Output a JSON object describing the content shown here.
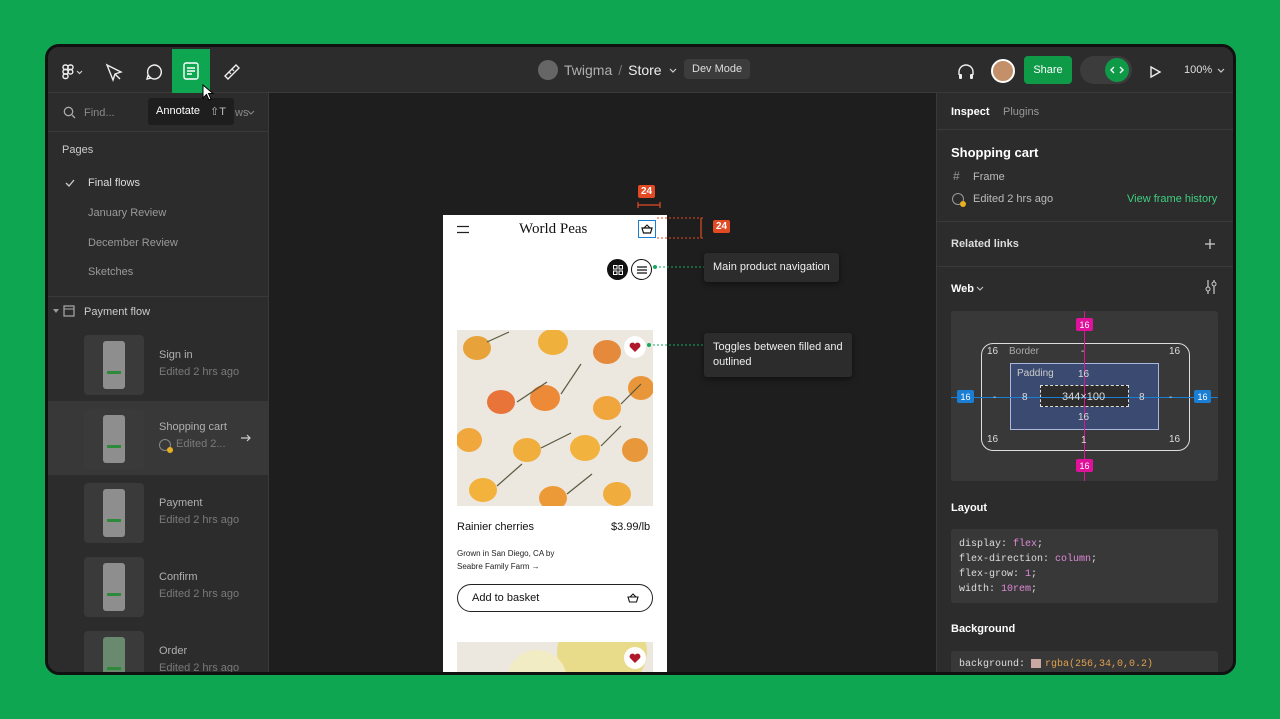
{
  "toolbar": {
    "project": "Twigma",
    "separator": "/",
    "file": "Store",
    "dev_mode": "Dev Mode",
    "share": "Share",
    "zoom": "100%"
  },
  "tooltip": {
    "label": "Annotate",
    "shortcut": "⇧T"
  },
  "left": {
    "find_placeholder": "Find...",
    "views_partial": "ws",
    "pages_title": "Pages",
    "pages": [
      {
        "label": "Final flows"
      },
      {
        "label": "January Review"
      },
      {
        "label": "December Review"
      },
      {
        "label": "Sketches"
      }
    ],
    "section": "Payment flow",
    "flows": [
      {
        "name": "Sign in",
        "sub": "Edited 2 hrs ago"
      },
      {
        "name": "Shopping cart",
        "sub": "Edited 2..."
      },
      {
        "name": "Payment",
        "sub": "Edited 2 hrs ago"
      },
      {
        "name": "Confirm",
        "sub": "Edited 2 hrs ago"
      },
      {
        "name": "Order",
        "sub": "Edited 2 hrs ago"
      }
    ]
  },
  "phone": {
    "brand": "World Peas",
    "product": "Rainier cherries",
    "price": "$3.99/lb",
    "origin": "Grown in San Diego, CA by",
    "farm": "Seabre Family Farm →",
    "cta": "Add to basket"
  },
  "annotations": {
    "nav": "Main product navigation",
    "fav1": "Toggles between filled and",
    "fav2": "outlined",
    "spacing": "24"
  },
  "right": {
    "tabs": [
      "Inspect",
      "Plugins"
    ],
    "title": "Shopping cart",
    "type": "Frame",
    "edited": "Edited 2 hrs ago",
    "history": "View frame history",
    "related": "Related links",
    "web": "Web",
    "box": {
      "margin": "16",
      "border_label": "Border",
      "border_top": "-",
      "padding_label": "Padding",
      "pad_top": "16",
      "pad_left": "8",
      "pad_right": "8",
      "pad_bottom": "16",
      "size": "344×100",
      "border_bottom": "1",
      "dash": "-"
    },
    "layout_title": "Layout",
    "layout": [
      {
        "prop": "display: ",
        "val": "flex",
        "end": ";"
      },
      {
        "prop": "flex-direction: ",
        "val": "column",
        "end": ";"
      },
      {
        "prop": "flex-grow: ",
        "val": "1",
        "end": ";"
      },
      {
        "prop": "width: ",
        "val": "10rem",
        "end": ";"
      }
    ],
    "bg_title": "Background",
    "bg_prop": "background: ",
    "bg_val": "rgba(256,34,0,0.2)",
    "bg_end": ")"
  },
  "colors": {
    "accent": "#0fa651",
    "annot_red": "#e24a24",
    "margin_pink": "#e0119a",
    "border_blue": "#1a7fd4",
    "padding_bg": "#3b4a70"
  }
}
